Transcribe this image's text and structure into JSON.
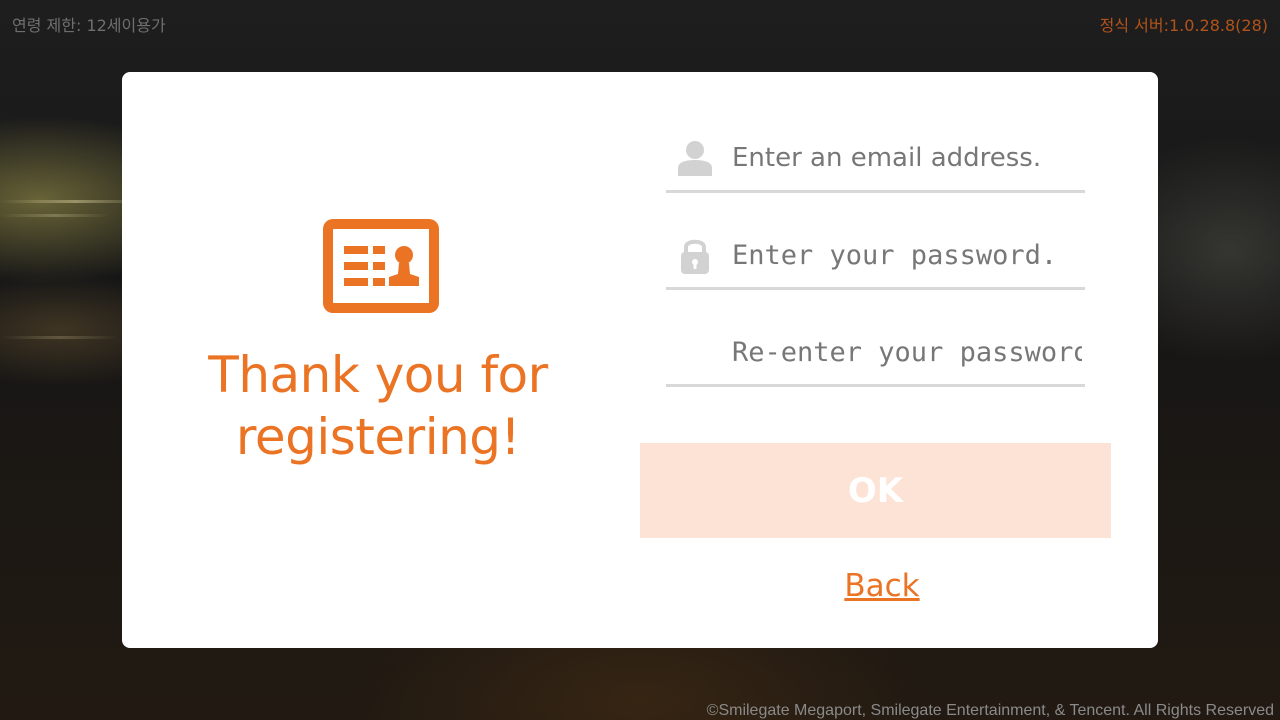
{
  "top_bar": {
    "age_rating": "연령 제한: 12세이용가",
    "server_version": "정식 서버:1.0.28.8(28)"
  },
  "dialog": {
    "icon": "registration-card-icon",
    "thanks_message": "Thank you for registering!",
    "email_field": {
      "icon": "user-icon",
      "placeholder": "Enter an email address.",
      "value": ""
    },
    "password_field": {
      "icon": "lock-icon",
      "placeholder": "Enter your password.",
      "value": ""
    },
    "confirm_password_field": {
      "placeholder": "Re-enter your password.",
      "value": ""
    },
    "ok_label": "OK",
    "back_label": "Back"
  },
  "footer": {
    "copyright": "©Smilegate Megaport, Smilegate Entertainment, & Tencent. All Rights Reserved"
  },
  "colors": {
    "accent": "#eb7324",
    "ok_button_disabled": "#fce3d5",
    "server_text": "#b2531b"
  }
}
